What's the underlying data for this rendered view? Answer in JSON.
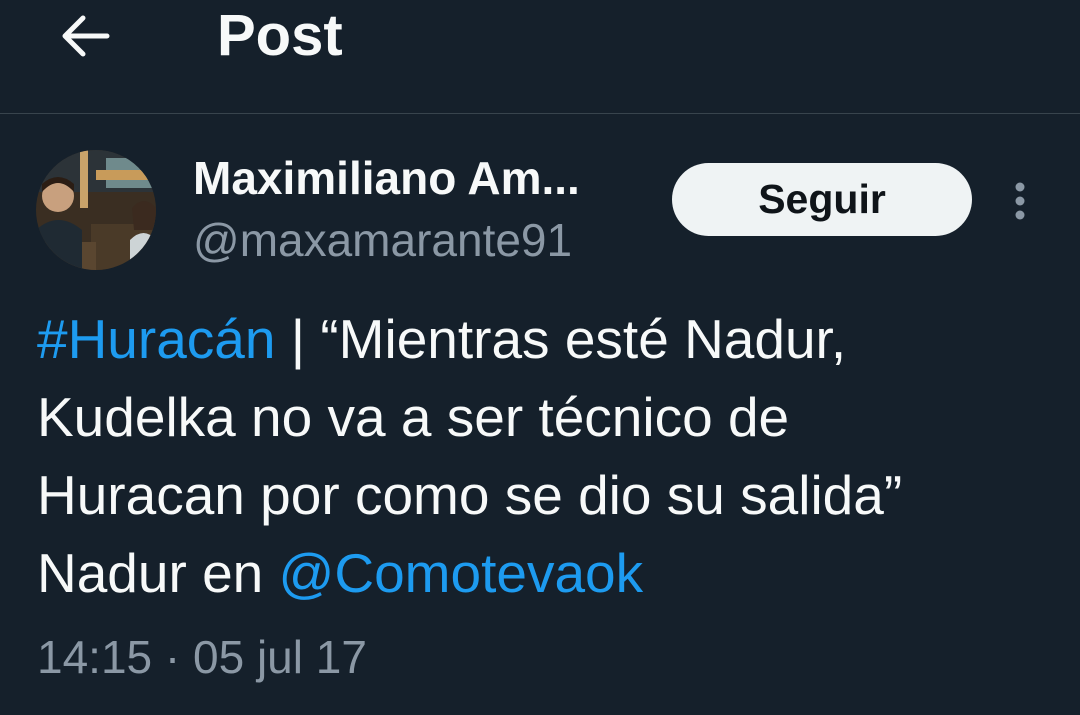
{
  "header": {
    "title": "Post",
    "back_icon": "arrow-left-icon"
  },
  "author": {
    "display_name": "Maximiliano Am...",
    "handle": "@maxamarante91",
    "follow_label": "Seguir",
    "more_icon": "more-vertical-icon"
  },
  "post": {
    "hashtag": "#Huracán",
    "separator": "|",
    "line1_rest": "“Mientras esté Nadur,",
    "line2": "Kudelka no va a ser técnico de",
    "line3": "Huracan por como se dio su salida”",
    "line4_prefix": "Nadur en",
    "mention": "@Comotevaok",
    "timestamp": "14:15 · 05 jul 17"
  },
  "colors": {
    "background": "#15202b",
    "text": "#f7f9f9",
    "secondary_text": "#8b98a5",
    "link": "#1d9bf0",
    "divider": "#38444d",
    "follow_button_bg": "#eff3f4"
  }
}
